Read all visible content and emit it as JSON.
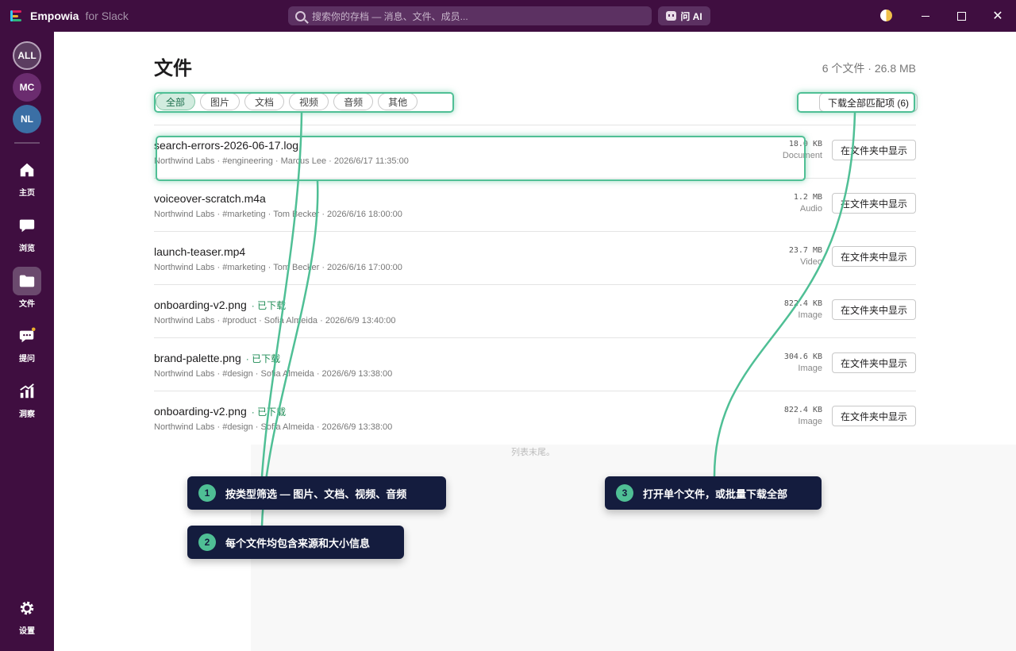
{
  "app": {
    "name": "Empowia",
    "sub": "for Slack",
    "search_placeholder": "搜索你的存档 — 消息、文件、成员...",
    "ai_label": "问 AI",
    "close_glyph": "✕"
  },
  "sidebar": {
    "workspaces": [
      "ALL",
      "MC",
      "NL"
    ],
    "nav": {
      "home": "主页",
      "browse": "浏览",
      "files": "文件",
      "ask": "提问",
      "insights": "洞察",
      "settings": "设置"
    }
  },
  "page": {
    "title": "文件",
    "summary": "6 个文件 · 26.8 MB",
    "filters": [
      "全部",
      "图片",
      "文档",
      "视频",
      "音频",
      "其他"
    ],
    "download_all": "下载全部匹配项 (6)",
    "end_note": "列表末尾。",
    "show_in_folder": "在文件夹中显示"
  },
  "files": [
    {
      "name": "search-errors-2026-06-17.log",
      "badge": "",
      "meta": "Northwind Labs · #engineering · Marcus Lee · 2026/6/17 11:35:00",
      "size": "18.0 KB",
      "type": "Document"
    },
    {
      "name": "voiceover-scratch.m4a",
      "badge": "",
      "meta": "Northwind Labs · #marketing · Tom Becker · 2026/6/16 18:00:00",
      "size": "1.2 MB",
      "type": "Audio"
    },
    {
      "name": "launch-teaser.mp4",
      "badge": "",
      "meta": "Northwind Labs · #marketing · Tom Becker · 2026/6/16 17:00:00",
      "size": "23.7 MB",
      "type": "Video"
    },
    {
      "name": "onboarding-v2.png",
      "badge": "· 已下载",
      "meta": "Northwind Labs · #product · Sofia Almeida · 2026/6/9 13:40:00",
      "size": "822.4 KB",
      "type": "Image"
    },
    {
      "name": "brand-palette.png",
      "badge": "· 已下载",
      "meta": "Northwind Labs · #design · Sofia Almeida · 2026/6/9 13:38:00",
      "size": "304.6 KB",
      "type": "Image"
    },
    {
      "name": "onboarding-v2.png",
      "badge": "· 已下载",
      "meta": "Northwind Labs · #design · Sofia Almeida · 2026/6/9 13:38:00",
      "size": "822.4 KB",
      "type": "Image"
    }
  ],
  "callouts": [
    {
      "num": "1",
      "text": "按类型筛选 — 图片、文档、视频、音频"
    },
    {
      "num": "2",
      "text": "每个文件均包含来源和大小信息"
    },
    {
      "num": "3",
      "text": "打开单个文件，或批量下载全部"
    }
  ],
  "colors": {
    "sidebar": "#3f0e40",
    "accent": "#4fbf95",
    "callout_bg": "#141c3e",
    "downloaded": "#1e8c55"
  }
}
